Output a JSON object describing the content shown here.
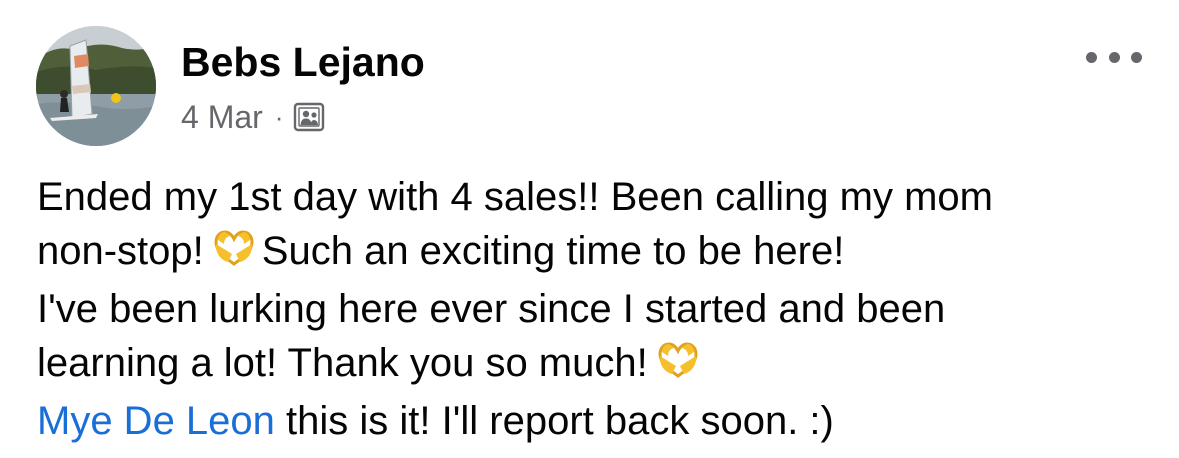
{
  "post": {
    "author": "Bebs Lejano",
    "date": "4 Mar",
    "separator": "·",
    "audience_icon": "group-members-icon",
    "more_icon": "more-options-icon",
    "body": {
      "line1": "Ended my 1st day with 4 sales!! Been calling my mom",
      "line2_before": "non-stop!",
      "line2_after": "Such an exciting time to be here!",
      "line3": "I've been lurking here ever since I started and been",
      "line4": "learning a lot! Thank you so much!",
      "mention": "Mye De Leon",
      "line5_after": " this is it! I'll report back soon. :)"
    },
    "emoji": "heart-hands-emoji",
    "colors": {
      "name": "#050505",
      "meta": "#65676b",
      "mention": "#1a6ed8",
      "emoji": "#f6c02c"
    }
  }
}
